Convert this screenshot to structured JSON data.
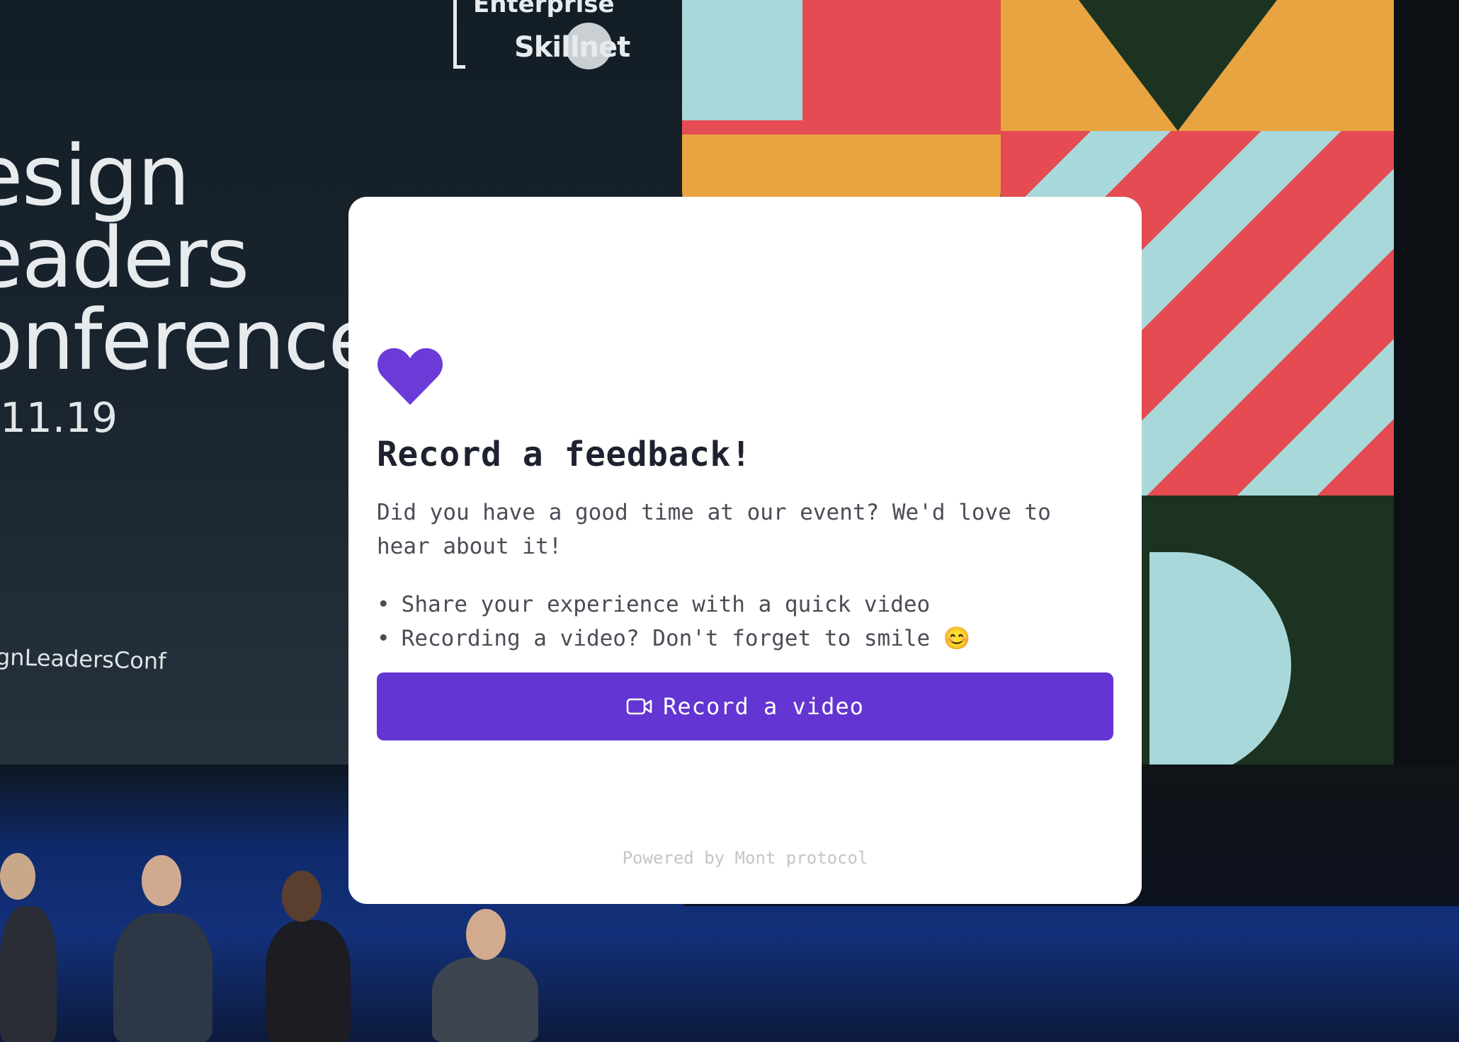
{
  "background": {
    "conference_title": "esign\neaders\nonference",
    "conference_date": "11.19",
    "hashtag": "gnLeadersConf",
    "logo_top": "Enterprise",
    "logo_bottom": "Skillnet"
  },
  "card": {
    "heart_icon": "heart-icon",
    "title": "Record a feedback!",
    "description": "Did you have a good time at our event? We'd love to hear about it!",
    "bullets": [
      "Share your experience with a quick video",
      "Recording a video? Don't forget to smile 😊"
    ],
    "bullet_glyph": "•",
    "record_button": {
      "icon": "video-camera-icon",
      "label": "Record a video"
    },
    "powered_by": "Powered by Mont protocol"
  },
  "colors": {
    "accent": "#6335d2",
    "heart": "#6b3bd8",
    "title": "#1e2230",
    "body_text": "#4a4d56",
    "footer_text": "#c3c5c9"
  }
}
